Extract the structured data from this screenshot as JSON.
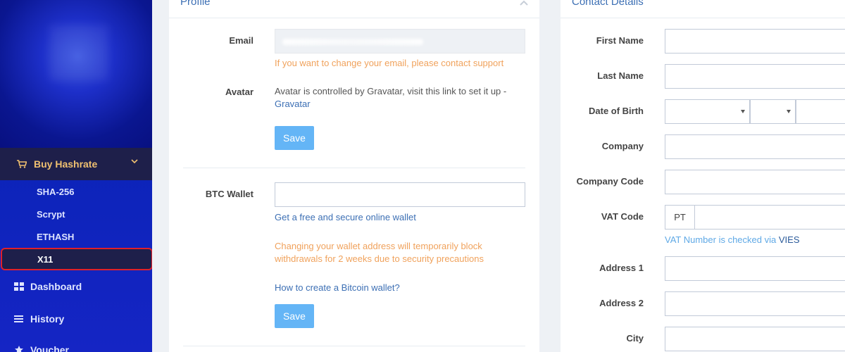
{
  "sidebar": {
    "active_section": "Buy Hashrate",
    "sub_items": [
      "SHA-256",
      "Scrypt",
      "ETHASH",
      "X11"
    ],
    "nav_items": [
      {
        "label": "Dashboard",
        "icon": "dashboard-icon"
      },
      {
        "label": "History",
        "icon": "list-icon"
      },
      {
        "label": "Voucher",
        "icon": "star-icon"
      }
    ]
  },
  "profile": {
    "title": "Profile",
    "email_label": "Email",
    "email_help": "If you want to change your email, please contact support",
    "avatar_label": "Avatar",
    "avatar_text": "Avatar is controlled by Gravatar, visit this link to set it up -",
    "avatar_link": "Gravatar",
    "save_label": "Save",
    "wallet_label": "BTC Wallet",
    "wallet_value": "",
    "wallet_link": "Get a free and secure online wallet",
    "wallet_warning": "Changing your wallet address will temporarily block withdrawals for 2 weeks due to security precautions",
    "wallet_howto": "How to create a Bitcoin wallet?",
    "save2_label": "Save"
  },
  "contact": {
    "title": "Contact Details",
    "first_name_label": "First Name",
    "last_name_label": "Last Name",
    "dob_label": "Date of Birth",
    "company_label": "Company",
    "company_code_label": "Company Code",
    "vat_label": "VAT Code",
    "vat_prefix": "PT",
    "vat_help": "VAT Number is checked via",
    "vat_link": "VIES",
    "address1_label": "Address 1",
    "address2_label": "Address 2",
    "city_label": "City"
  },
  "colors": {
    "accent": "#3c6fb4",
    "warning": "#f0a25c",
    "button": "#64b5f6",
    "sidebar_active": "#1e1f4a",
    "highlight": "#e0202a"
  }
}
